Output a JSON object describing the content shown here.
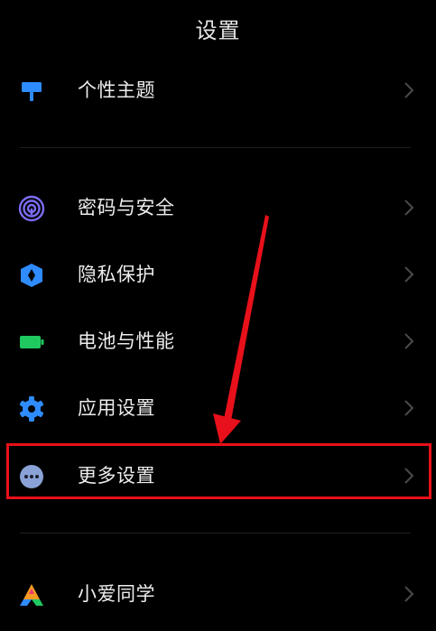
{
  "header": {
    "title": "设置"
  },
  "items": [
    {
      "label": "个性主题",
      "icon": "paint-brush-icon",
      "color": "#2f8cff"
    },
    {
      "label": "密码与安全",
      "icon": "fingerprint-icon",
      "color": "#7b6cf2"
    },
    {
      "label": "隐私保护",
      "icon": "privacy-shield-icon",
      "color": "#2f8cff"
    },
    {
      "label": "电池与性能",
      "icon": "battery-icon",
      "color": "#1fc960"
    },
    {
      "label": "应用设置",
      "icon": "gear-icon",
      "color": "#2f8cff"
    },
    {
      "label": "更多设置",
      "icon": "more-dots-icon",
      "color": "#8aa2d6"
    },
    {
      "label": "小爱同学",
      "icon": "xiaoai-logo-icon",
      "color": "#f59a23"
    }
  ],
  "annotation": {
    "highlight_color": "#e8101a"
  }
}
